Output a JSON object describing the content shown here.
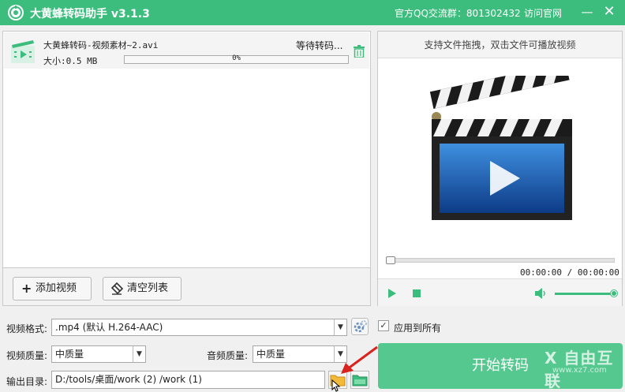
{
  "app": {
    "title": "大黄蜂转码助手 v3.1.3",
    "qq_group": "官方QQ交流群：801302432",
    "official_site": "访问官网",
    "minimize_symbol": "—",
    "close_symbol": "✕"
  },
  "file_list": {
    "items": [
      {
        "name": "大黄蜂转码-视频素材~2.avi",
        "status": "等待转码...",
        "size": "大小:0.5 MB",
        "progress": 0,
        "progress_text": "0%"
      }
    ]
  },
  "list_buttons": {
    "add": "添加视频",
    "add_icon": "+",
    "clear": "清空列表"
  },
  "preview": {
    "hint": "支持文件拖拽，双击文件可播放视频",
    "time": "00:00:00 / 00:00:00",
    "seek_position": 0,
    "volume": 1.0
  },
  "settings": {
    "format_label": "视频格式:",
    "format_value": ".mp4 (默认 H.264-AAC)",
    "apply_all_label": "应用到所有",
    "apply_all_checked": "✓",
    "video_quality_label": "视频质量:",
    "video_quality_value": "中质量",
    "audio_quality_label": "音频质量:",
    "audio_quality_value": "中质量",
    "output_label": "输出目录:",
    "output_path": "D:/tools/桌面/work (2) /work (1)"
  },
  "start_button": "开始转码",
  "watermark": {
    "text": "X 自由互联",
    "url": "www.xz7.com"
  },
  "colors": {
    "accent": "#3cbd7d",
    "start_button": "#55c88f",
    "folder": "#f2b93b",
    "annotation_arrow": "#d9231d"
  },
  "dropdown_arrow": "▼"
}
